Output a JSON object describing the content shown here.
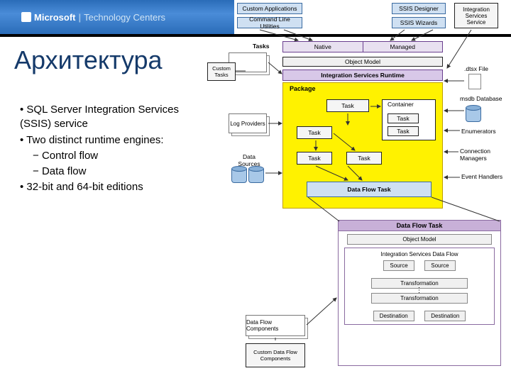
{
  "header": {
    "brand": "Microsoft",
    "suffix": "Technology Centers"
  },
  "title": "Архитектура",
  "bullets": {
    "b1": "SQL Server Integration Services (SSIS) service",
    "b2": "Two distinct runtime engines:",
    "b2a": "Control flow",
    "b2b": "Data flow",
    "b3": "32-bit and 64-bit editions"
  },
  "top_row": {
    "custom_apps": "Custom Applications",
    "cmdline": "Command Line Utilities",
    "ssis_designer": "SSIS Designer",
    "ssis_wizards": "SSIS Wizards",
    "isservice": "Integration Services Service"
  },
  "mid_row": {
    "tasks": "Tasks",
    "native": "Native",
    "managed": "Managed",
    "object_model": "Object Model",
    "runtime": "Integration Services Runtime",
    "custom_tasks": "Custom Tasks",
    "package": "Package",
    "log_providers": "Log Providers",
    "data_sources": "Data Sources",
    "task": "Task",
    "container": "Container",
    "dataflow_task": "Data Flow Task",
    "dtsx": ".dtsx File",
    "msdb": "msdb Database",
    "enumerators": "Enumerators",
    "conn_mgrs": "Connection Managers",
    "event_handlers": "Event Handlers"
  },
  "data_flow_panel": {
    "title": "Data Flow Task",
    "object_model": "Object Model",
    "pipeline": "Integration Services Data Flow",
    "source": "Source",
    "transformation": "Transformation",
    "destination": "Destination"
  },
  "bottom_left": {
    "df_components": "Data Flow Components",
    "custom_df_components": "Custom Data Flow Components"
  },
  "chart_data": {
    "type": "diagram",
    "title": "SSIS Architecture",
    "description": "Block diagram of SQL Server Integration Services architecture showing clients (Custom Applications, Command Line Utilities, SSIS Designer, SSIS Wizards, Integration Services Service) connecting via Native/Managed APIs and Object Model to the Integration Services Runtime. The Runtime hosts a Package containing Tasks, Containers and a Data Flow Task, and integrates with Tasks, Custom Tasks, Log Providers, Data Sources, .dtsx File, msdb Database, Enumerators, Connection Managers and Event Handlers. A zoomed Data Flow Task panel shows Object Model → Integration Services Data Flow with Source → Transformation → … → Transformation → Destination pipeline, fed by Data Flow Components and Custom Data Flow Components."
  }
}
